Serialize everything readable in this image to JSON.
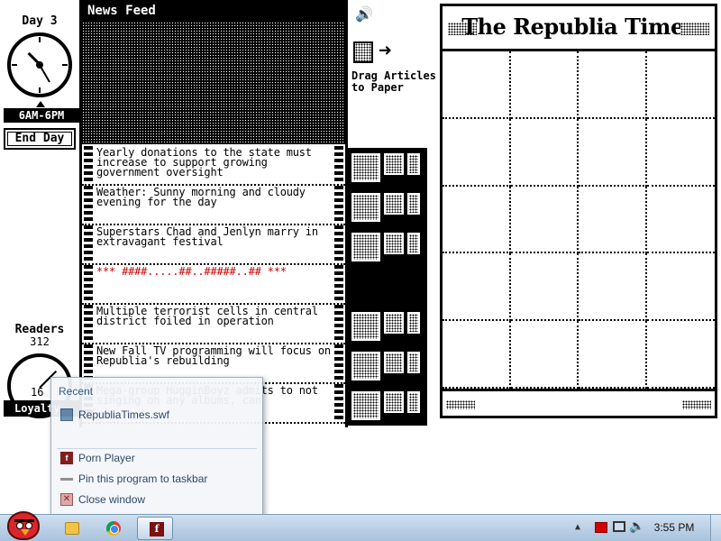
{
  "game": {
    "day_label": "Day 3",
    "time_range": "6AM-6PM",
    "end_day_label": "End Day",
    "readers_label": "Readers",
    "readers_count": "312",
    "loyalty_label": "Loyalty",
    "loyalty_value": "16"
  },
  "feed": {
    "title": "News Feed",
    "stories": [
      {
        "text": "Yearly donations to the state must increase to support growing government oversight",
        "censored": false
      },
      {
        "text": "Weather: Sunny morning and cloudy evening for the day",
        "censored": false
      },
      {
        "text": "Superstars Chad and Jenlyn marry in extravagant festival",
        "censored": false
      },
      {
        "text": "*** ####.....##..#####..## ***",
        "censored": true
      },
      {
        "text": "Multiple terrorist cells in central district foiled in operation",
        "censored": false
      },
      {
        "text": "New Fall TV programming will focus on Republia's rebuilding",
        "censored": false
      },
      {
        "text": "Mega-group HugginBoyz admits to not singing on any albums, can",
        "censored": false
      }
    ]
  },
  "actions": {
    "drag_label": "Drag Articles to Paper",
    "sound_icon": "speaker-icon"
  },
  "paper": {
    "masthead": "The Republia Times"
  },
  "jumplist": {
    "recent_heading": "Recent",
    "recent_item": "RepubliaTimes.swf",
    "app_name": "Porn Player",
    "pin_label": "Pin this program to taskbar",
    "close_label": "Close window"
  },
  "taskbar": {
    "clock": "3:55 PM"
  },
  "colors": {
    "censored_text": "#cc0000",
    "taskbar_top": "#cfe0f0",
    "taskbar_bottom": "#a9c3dc",
    "start_bird": "#d8262b"
  }
}
